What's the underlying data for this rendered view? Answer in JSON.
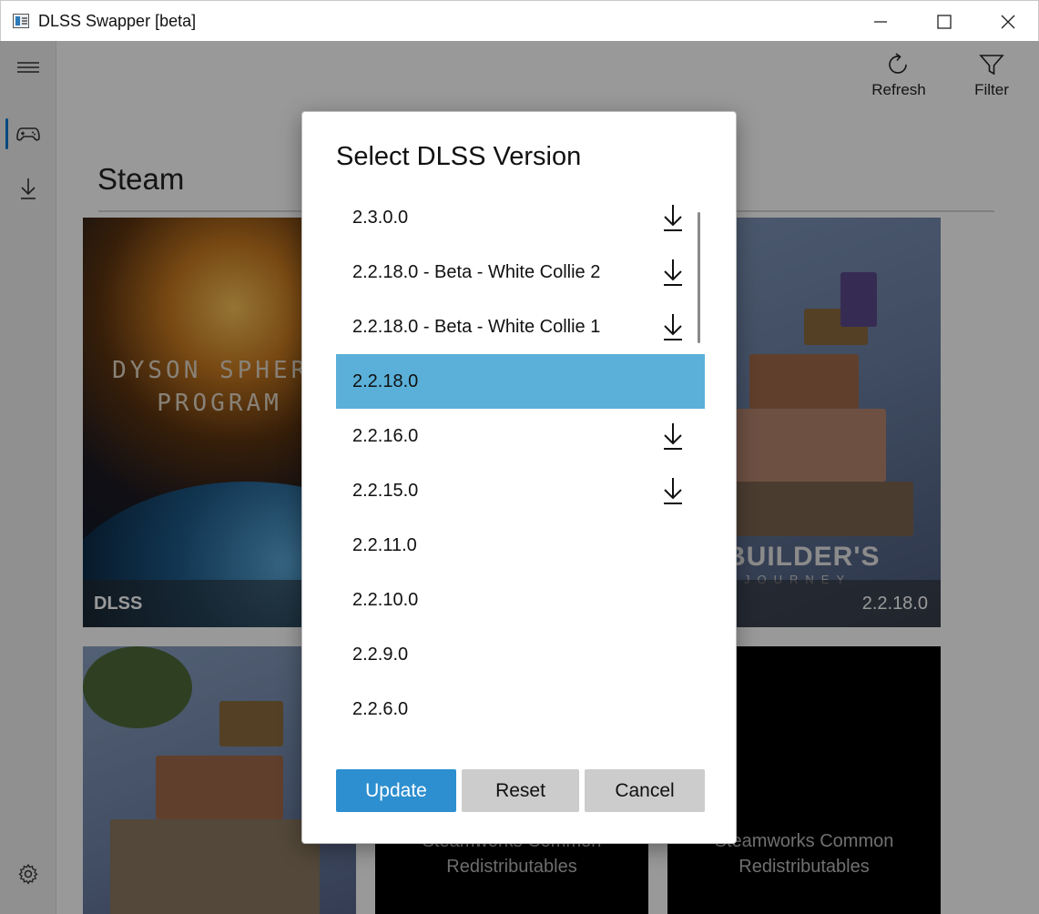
{
  "window": {
    "title": "DLSS Swapper [beta]",
    "icons": [
      "app-icon",
      "minimize-icon",
      "maximize-icon",
      "close-icon"
    ]
  },
  "nav": {
    "icons": [
      "hamburger-icon",
      "gamepad-icon",
      "download-icon",
      "gear-icon"
    ],
    "accent": "#0078d4"
  },
  "commands": {
    "refresh_label": "Refresh",
    "filter_label": "Filter"
  },
  "library": {
    "section_title": "Steam",
    "tiles": [
      {
        "art_text": "DYSON SPHERE PROGRAM",
        "caption_left": "DLSS",
        "caption_right": ""
      },
      {
        "art_text": "BUILDER'S",
        "art_subtext": "JOURNEY",
        "caption_left": "",
        "caption_right": "2.2.18.0"
      },
      {
        "caption_left": "",
        "caption_right": ""
      },
      {
        "redist_line1": "Steamworks Common",
        "redist_line2": "Redistributables"
      },
      {
        "redist_line1": "Steamworks Common",
        "redist_line2": "Redistributables"
      }
    ]
  },
  "dialog": {
    "title": "Select DLSS Version",
    "versions": [
      {
        "label": "2.3.0.0",
        "downloadable": true,
        "selected": false
      },
      {
        "label": "2.2.18.0 - Beta - White Collie 2",
        "downloadable": true,
        "selected": false
      },
      {
        "label": "2.2.18.0 - Beta - White Collie 1",
        "downloadable": true,
        "selected": false
      },
      {
        "label": "2.2.18.0",
        "downloadable": false,
        "selected": true
      },
      {
        "label": "2.2.16.0",
        "downloadable": true,
        "selected": false
      },
      {
        "label": "2.2.15.0",
        "downloadable": true,
        "selected": false
      },
      {
        "label": "2.2.11.0",
        "downloadable": false,
        "selected": false
      },
      {
        "label": "2.2.10.0",
        "downloadable": false,
        "selected": false
      },
      {
        "label": "2.2.9.0",
        "downloadable": false,
        "selected": false
      },
      {
        "label": "2.2.6.0",
        "downloadable": false,
        "selected": false
      }
    ],
    "buttons": {
      "update": "Update",
      "reset": "Reset",
      "cancel": "Cancel"
    },
    "colors": {
      "selected_row": "#5ab0d9",
      "primary_button": "#2d8fcf",
      "secondary_button": "#cccccc"
    }
  }
}
